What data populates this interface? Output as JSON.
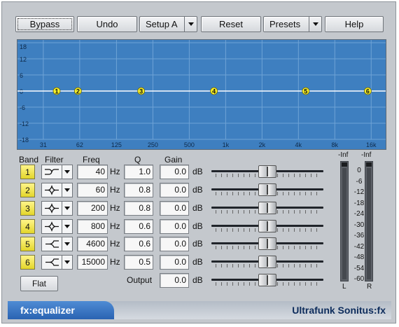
{
  "toolbar": {
    "bypass": "Bypass",
    "undo": "Undo",
    "setup": "Setup A",
    "reset": "Reset",
    "presets": "Presets",
    "help": "Help"
  },
  "graph": {
    "db_labels": [
      "18",
      "12",
      "6",
      "0",
      "-6",
      "-12",
      "-18"
    ],
    "freq_labels": [
      "31",
      "62",
      "125",
      "250",
      "500",
      "1k",
      "2k",
      "4k",
      "8k",
      "16k"
    ],
    "colors": {
      "background": "#3e7fc0",
      "grid": "#6fa3d6",
      "curve": "#ffffff",
      "node": "#f5ef28"
    }
  },
  "headers": {
    "band": "Band",
    "filter": "Filter",
    "freq": "Freq",
    "q": "Q",
    "gain": "Gain"
  },
  "bands": [
    {
      "label": "1",
      "filter_icon": "high-pass-filter-icon",
      "freq": "40",
      "q": "1.0",
      "gain": "0.0",
      "slider_level_db": 0
    },
    {
      "label": "2",
      "filter_icon": "peak-filter-icon",
      "freq": "60",
      "q": "0.8",
      "gain": "0.0",
      "slider_level_db": 0
    },
    {
      "label": "3",
      "filter_icon": "peak-filter-icon",
      "freq": "200",
      "q": "0.8",
      "gain": "0.0",
      "slider_level_db": 0
    },
    {
      "label": "4",
      "filter_icon": "peak-filter-icon",
      "freq": "800",
      "q": "0.6",
      "gain": "0.0",
      "slider_level_db": 0
    },
    {
      "label": "5",
      "filter_icon": "high-shelf-filter-icon",
      "freq": "4600",
      "q": "0.6",
      "gain": "0.0",
      "slider_level_db": 0
    },
    {
      "label": "6",
      "filter_icon": "high-shelf-filter-icon",
      "freq": "15000",
      "q": "0.5",
      "gain": "0.0",
      "slider_level_db": 0
    }
  ],
  "units": {
    "hz": "Hz",
    "db": "dB"
  },
  "output": {
    "label": "Output",
    "gain": "0.0"
  },
  "flat": "Flat",
  "meters": {
    "left_peak": "-Inf",
    "right_peak": "-Inf",
    "scale": [
      "0",
      "-6",
      "-12",
      "-18",
      "-24",
      "-30",
      "-36",
      "-42",
      "-48",
      "-54",
      "-60"
    ],
    "left_label": "L",
    "right_label": "R"
  },
  "footer": {
    "product": "fx:equalizer",
    "brand": "Ultrafunk Sonitus:fx"
  }
}
